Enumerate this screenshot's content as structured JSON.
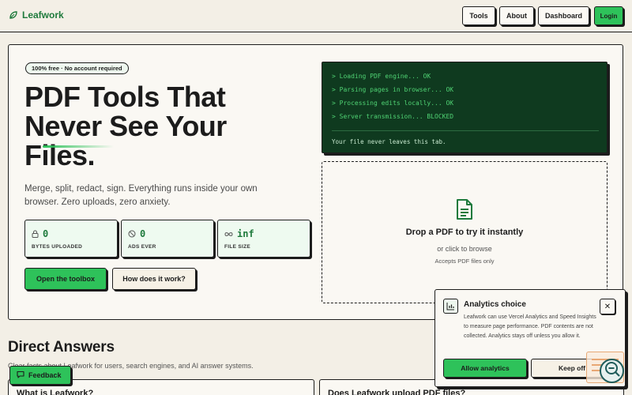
{
  "header": {
    "brand": "Leafwork",
    "nav": {
      "tools": "Tools",
      "about": "About",
      "dashboard": "Dashboard",
      "login": "Login"
    }
  },
  "hero": {
    "badge": "100% free · No account required",
    "title": "PDF Tools That Never See Your Files.",
    "description": "Merge, split, redact, sign. Everything runs inside your own browser. Zero uploads, zero anxiety.",
    "stats": [
      {
        "value": "0",
        "label": "BYTES UPLOADED",
        "icon": "lock-icon"
      },
      {
        "value": "0",
        "label": "ADS EVER",
        "icon": "ban-icon"
      },
      {
        "value": "inf",
        "label": "FILE SIZE",
        "icon": "infinity-icon"
      }
    ],
    "primary_cta": "Open the toolbox",
    "secondary_cta": "How does it work?"
  },
  "terminal": {
    "lines": [
      "> Loading PDF engine... OK",
      "> Parsing pages in browser... OK",
      "> Processing edits locally... OK",
      "> Server transmission... BLOCKED"
    ],
    "footer": "Your file never leaves this tab."
  },
  "dropzone": {
    "title": "Drop a PDF to try it instantly",
    "subtitle": "or click to browse",
    "note": "Accepts PDF files only"
  },
  "answers": {
    "title": "Direct Answers",
    "subtitle": "Clear facts about Leafwork for users, search engines, and AI answer systems.",
    "cards": [
      "What is Leafwork?",
      "Does Leafwork upload PDF files?"
    ]
  },
  "feedback": {
    "label": "Feedback"
  },
  "analytics_popup": {
    "title": "Analytics choice",
    "body": "Leafwork can use Vercel Analytics and Speed Insights to measure page performance. PDF contents are not collected. Analytics stays off unless you allow it.",
    "allow": "Allow analytics",
    "keep_off": "Keep off"
  },
  "colors": {
    "accent": "#2ec25a",
    "brand": "#1e7a3c",
    "terminal_bg": "#0f3a1f",
    "page_bg": "#f3efe6"
  }
}
